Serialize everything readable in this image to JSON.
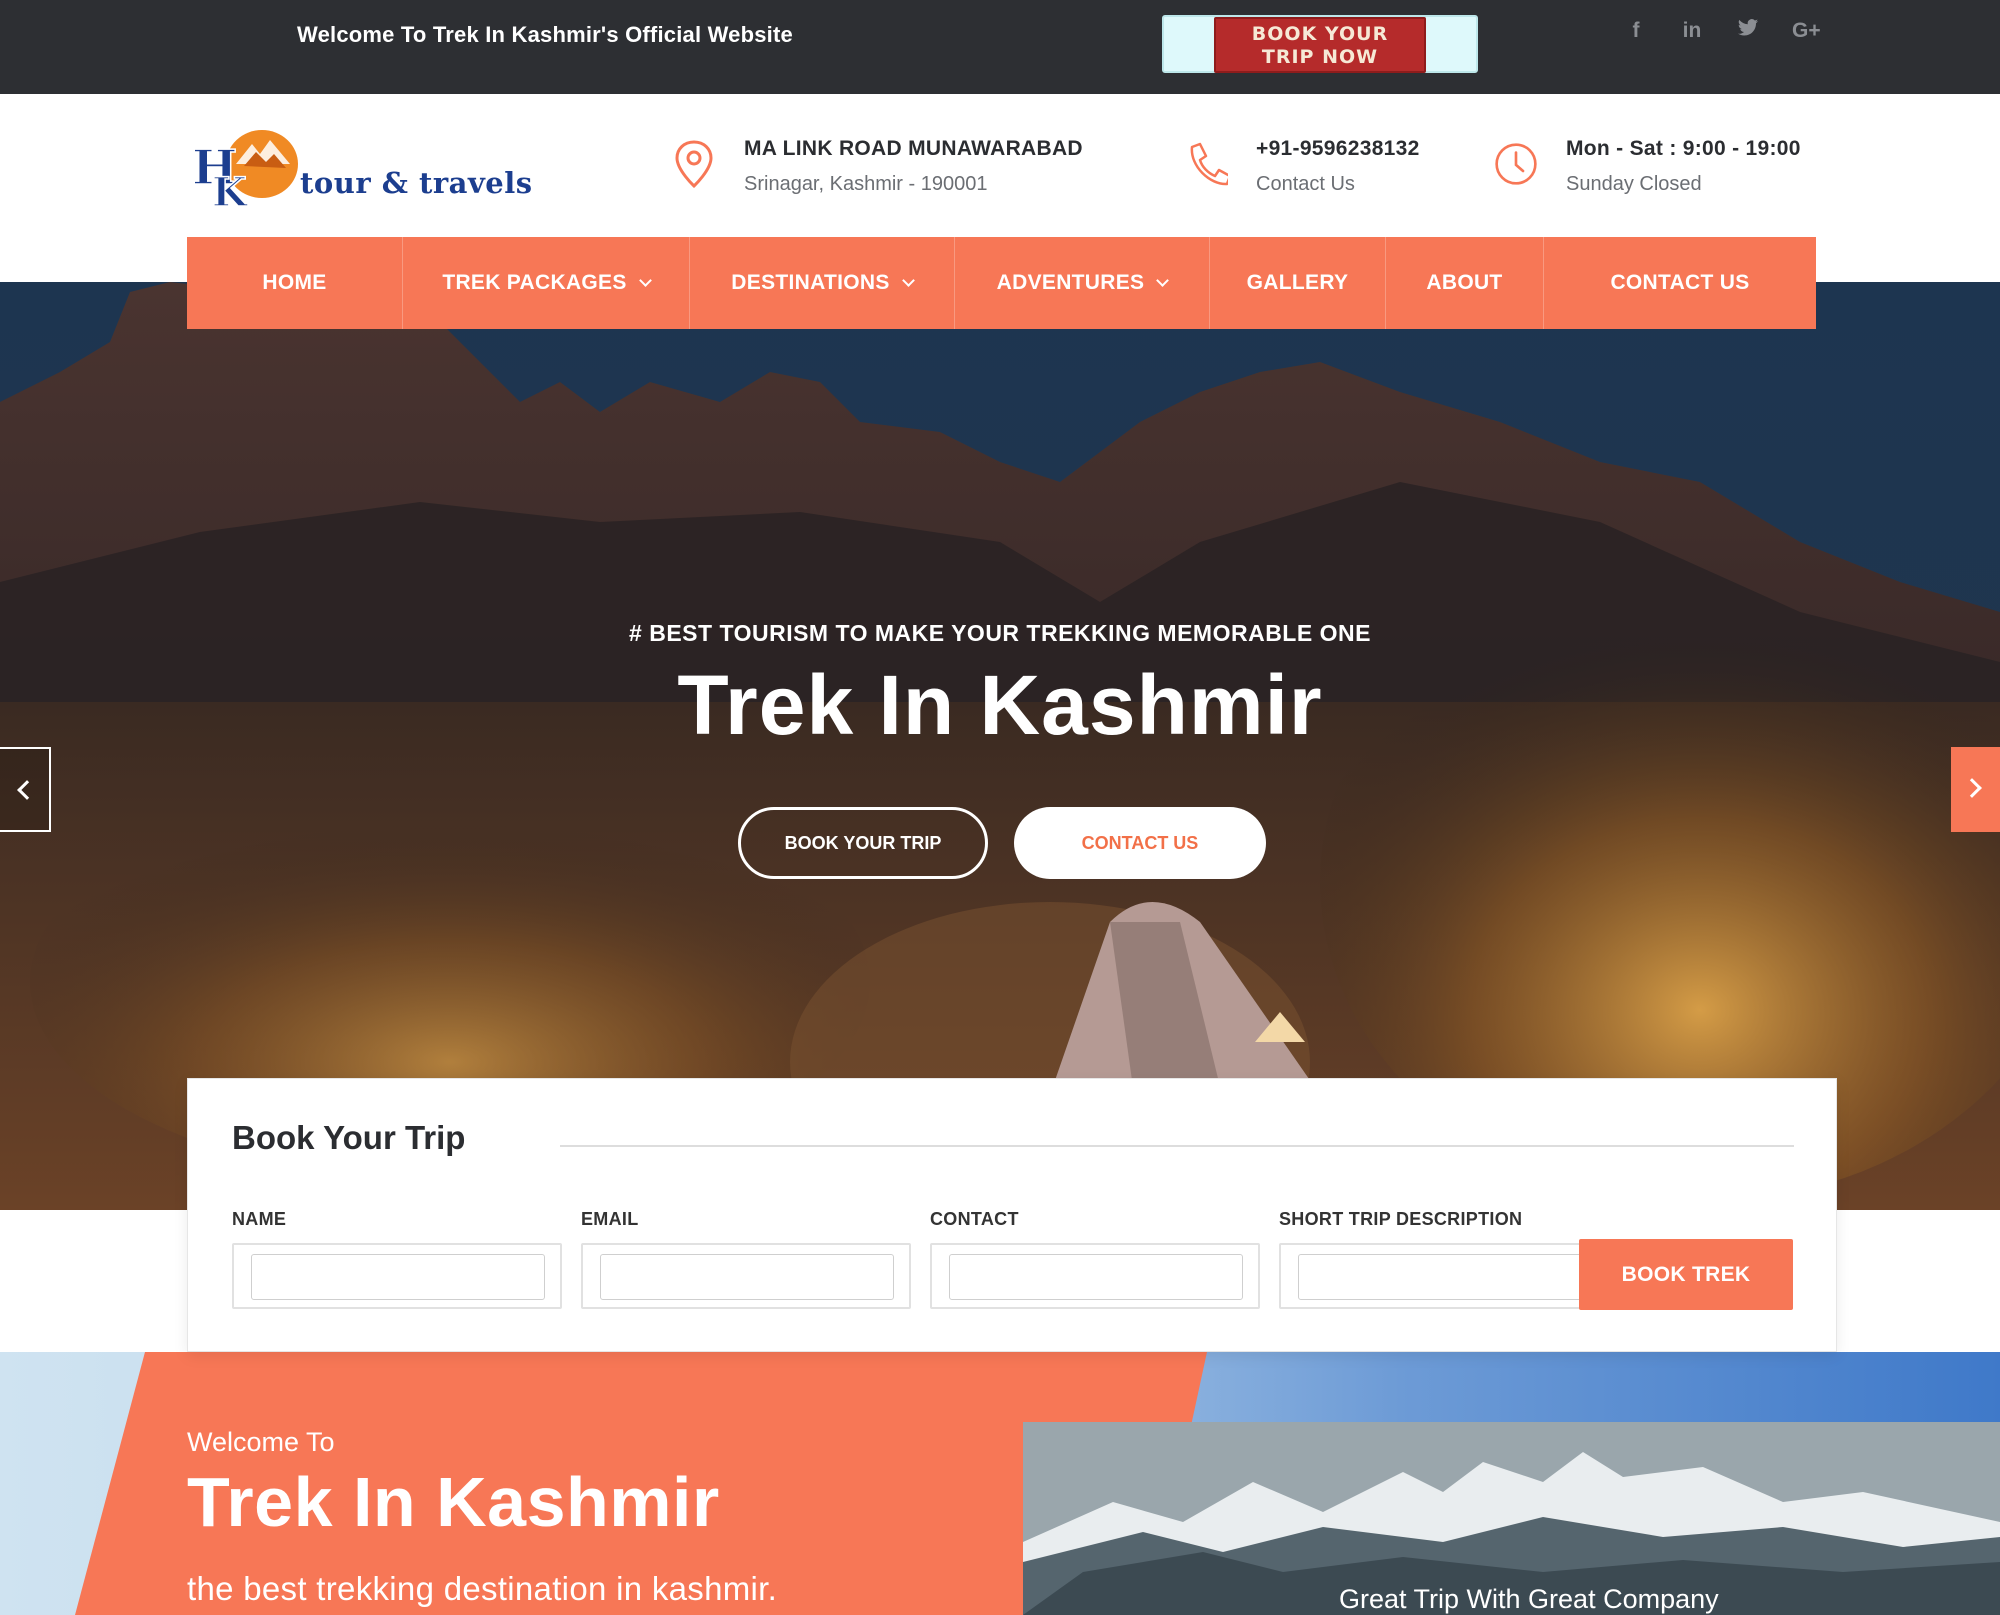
{
  "topbar": {
    "welcome": "Welcome To Trek In Kashmir's Official Website",
    "book_banner": [
      "BOOK YOUR",
      "TRIP NOW"
    ],
    "socials": [
      {
        "name": "facebook-icon",
        "glyph": "f"
      },
      {
        "name": "linkedin-icon",
        "glyph": "in"
      },
      {
        "name": "twitter-icon",
        "glyph": "t"
      },
      {
        "name": "google-plus-icon",
        "glyph": "G+"
      }
    ]
  },
  "logo": {
    "text": "tour & travels",
    "mark": "HK"
  },
  "contact_info": {
    "address": {
      "line1": "MA LINK ROAD MUNAWARABAD",
      "line2": "Srinagar, Kashmir - 190001",
      "icon": "location-pin-icon"
    },
    "phone": {
      "line1": "+91-9596238132",
      "line2": "Contact Us",
      "icon": "phone-icon"
    },
    "hours": {
      "line1": "Mon - Sat : 9:00 - 19:00",
      "line2": "Sunday Closed",
      "icon": "clock-icon"
    }
  },
  "nav": {
    "items": [
      {
        "label": "HOME",
        "dropdown": false
      },
      {
        "label": "TREK PACKAGES",
        "dropdown": true
      },
      {
        "label": "DESTINATIONS",
        "dropdown": true
      },
      {
        "label": "ADVENTURES",
        "dropdown": true
      },
      {
        "label": "GALLERY",
        "dropdown": false
      },
      {
        "label": "ABOUT",
        "dropdown": false
      },
      {
        "label": "CONTACT US",
        "dropdown": false
      }
    ]
  },
  "hero": {
    "eyebrow": "# BEST TOURISM TO MAKE YOUR TREKKING MEMORABLE ONE",
    "title": "Trek In Kashmir",
    "primary_button": "BOOK YOUR TRIP",
    "secondary_button": "CONTACT US"
  },
  "booking": {
    "title": "Book Your Trip",
    "fields": [
      {
        "label": "NAME",
        "value": ""
      },
      {
        "label": "EMAIL",
        "value": ""
      },
      {
        "label": "CONTACT",
        "value": ""
      },
      {
        "label": "SHORT TRIP DESCRIPTION",
        "value": ""
      }
    ],
    "submit": "BOOK TREK"
  },
  "welcome": {
    "intro": "Welcome To",
    "title": "Trek In Kashmir",
    "subtitle": "the best trekking destination in kashmir.",
    "photo_caption": "Great Trip With Great Company"
  },
  "colors": {
    "accent": "#f77756",
    "topbar": "#2d2f33",
    "text_dark": "#2b2d31"
  }
}
